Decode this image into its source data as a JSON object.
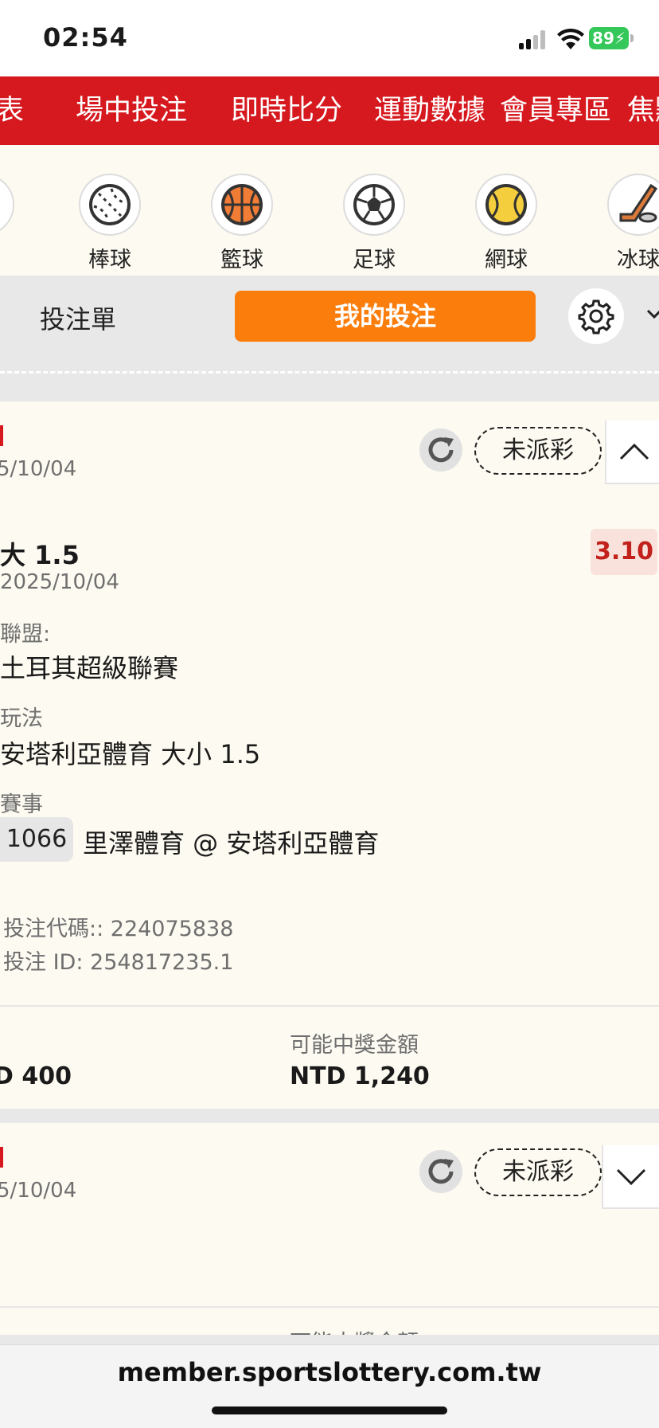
{
  "status_bar": {
    "time": "02:54",
    "battery": "89"
  },
  "nav": {
    "items": [
      "賽表",
      "場中投注",
      "即時比分",
      "運動數據",
      "會員專區",
      "焦點"
    ]
  },
  "sports": [
    {
      "label": "棒球",
      "icon": "baseball-icon"
    },
    {
      "label": "籃球",
      "icon": "basketball-icon"
    },
    {
      "label": "足球",
      "icon": "soccer-ball-icon"
    },
    {
      "label": "網球",
      "icon": "tennis-ball-icon"
    },
    {
      "label": "冰球",
      "icon": "ice-hockey-icon"
    }
  ],
  "tabs": {
    "betslip": "投注單",
    "my_bets": "我的投注"
  },
  "bet1": {
    "header_date": "5/10/04",
    "status": "未派彩",
    "selection": "大 1.5",
    "date": "2025/10/04",
    "odds": "3.10",
    "league_label": "聯盟:",
    "league": "土耳其超級聯賽",
    "market_label": "玩法",
    "market": "安塔利亞體育 大小 1.5",
    "event_label": "賽事",
    "event_code": "1066",
    "event": "里澤體育 @ 安塔利亞體育",
    "bet_code": "投注代碼:: 224075838",
    "bet_id": "投注 ID: 254817235.1",
    "potential_label": "可能中獎金額",
    "stake": "D 400",
    "potential": "NTD 1,240"
  },
  "bet2": {
    "header_date": "5/10/04",
    "status": "未派彩",
    "potential_label": "可能中獎金額"
  },
  "url": "member.sportslottery.com.tw",
  "colors": {
    "brand_red": "#d6191f",
    "orange": "#fb7d0c",
    "odds_red": "#c2211c"
  }
}
